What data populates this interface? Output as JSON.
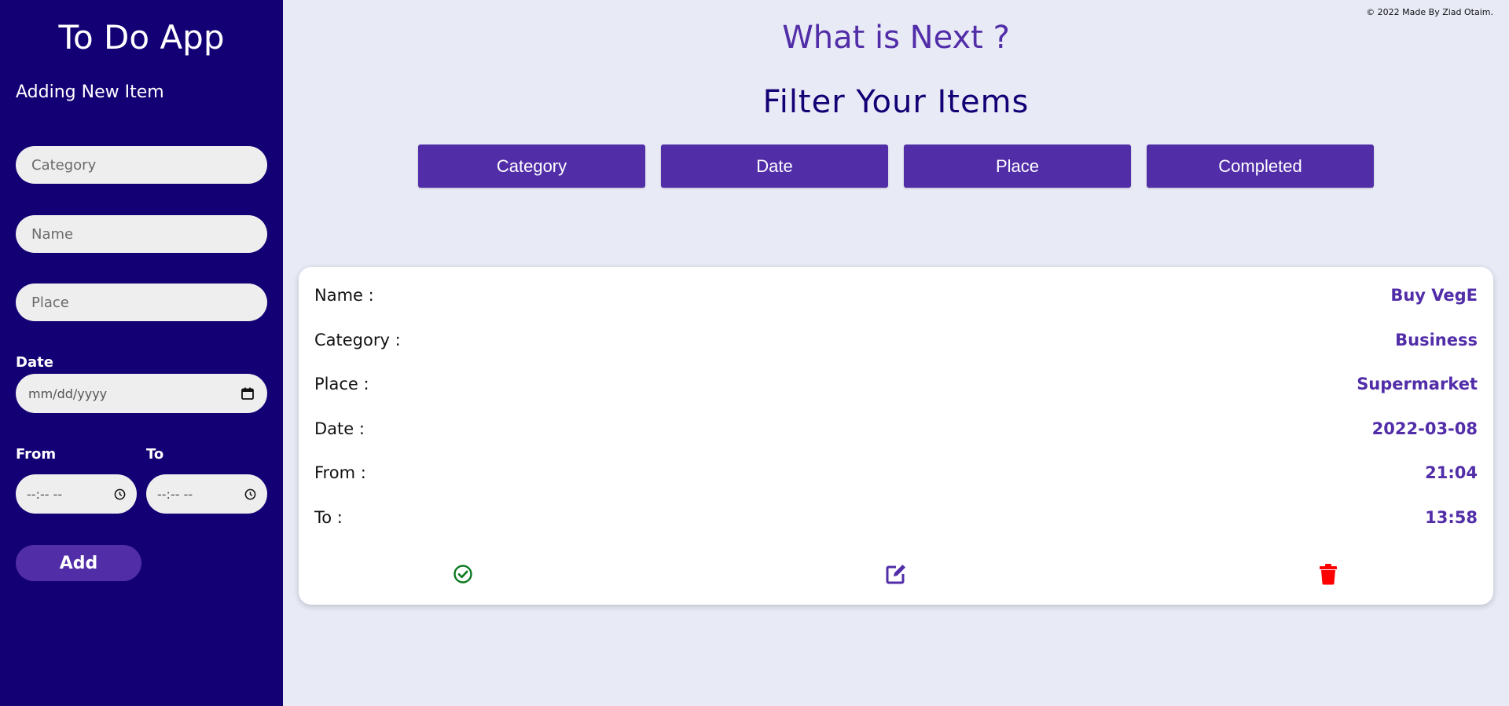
{
  "sidebar": {
    "app_title": "To Do App",
    "subtitle": "Adding New Item",
    "category_placeholder": "Category",
    "name_placeholder": "Name",
    "place_placeholder": "Place",
    "date_label": "Date",
    "date_placeholder": "mm/dd/yyyy",
    "from_label": "From",
    "to_label": "To",
    "time_placeholder": "--:-- --",
    "add_label": "Add"
  },
  "header": {
    "copyright": "© 2022 Made By Ziad Otaim.",
    "title": "What is Next ?",
    "filter_title": "Filter Your Items"
  },
  "filters": [
    {
      "label": "Category"
    },
    {
      "label": "Date"
    },
    {
      "label": "Place"
    },
    {
      "label": "Completed"
    }
  ],
  "item": {
    "rows": [
      {
        "label": "Name :",
        "value": "Buy VegE"
      },
      {
        "label": "Category :",
        "value": "Business"
      },
      {
        "label": "Place :",
        "value": "Supermarket"
      },
      {
        "label": "Date :",
        "value": "2022-03-08"
      },
      {
        "label": "From :",
        "value": "21:04"
      },
      {
        "label": "To :",
        "value": "13:58"
      }
    ],
    "actions": {
      "complete_icon": "check-circle-icon",
      "edit_icon": "edit-icon",
      "delete_icon": "trash-icon"
    }
  },
  "colors": {
    "sidebar_bg": "#140075",
    "accent": "#512da8",
    "page_bg": "#e8eaf6",
    "complete": "#0a7a1f",
    "delete": "#ff0000"
  }
}
